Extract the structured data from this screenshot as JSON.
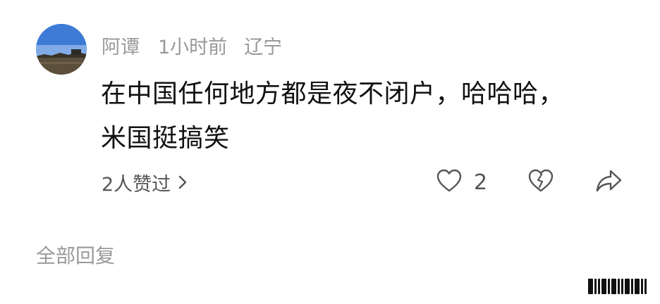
{
  "comment": {
    "author": "阿谭",
    "time": "1小时前",
    "location": "辽宁",
    "text_line1": "在中国任何地方都是夜不闭户，哈哈哈，",
    "text_line2": "米国挺搞笑",
    "likes_summary": "2人赞过",
    "like_count": "2"
  },
  "icons": {
    "chevron": "chevron-right-icon",
    "like": "heart-outline-icon",
    "dislike": "broken-heart-icon",
    "share": "share-arrow-icon"
  },
  "colors": {
    "meta_gray": "#999999",
    "text_dark": "#111111",
    "action_gray": "#555555"
  },
  "replies": {
    "heading": "全部回复"
  }
}
